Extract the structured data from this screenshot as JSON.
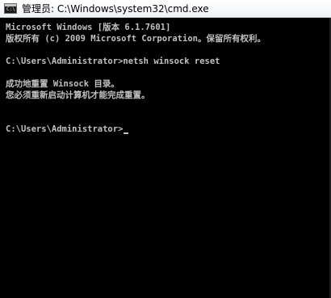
{
  "window": {
    "title": "管理员: C:\\Windows\\system32\\cmd.exe",
    "icon": "cmd-icon",
    "icon_glyph": "C:\\"
  },
  "console": {
    "lines": [
      "Microsoft Windows [版本 6.1.7601]",
      "版权所有 (c) 2009 Microsoft Corporation。保留所有权利。",
      "",
      "C:\\Users\\Administrator>netsh winsock reset",
      "",
      "成功地重置 Winsock 目录。",
      "您必须重新启动计算机才能完成重置。",
      "",
      ""
    ],
    "prompt": "C:\\Users\\Administrator>",
    "colors": {
      "background": "#000000",
      "foreground": "#c0c0c0"
    }
  }
}
